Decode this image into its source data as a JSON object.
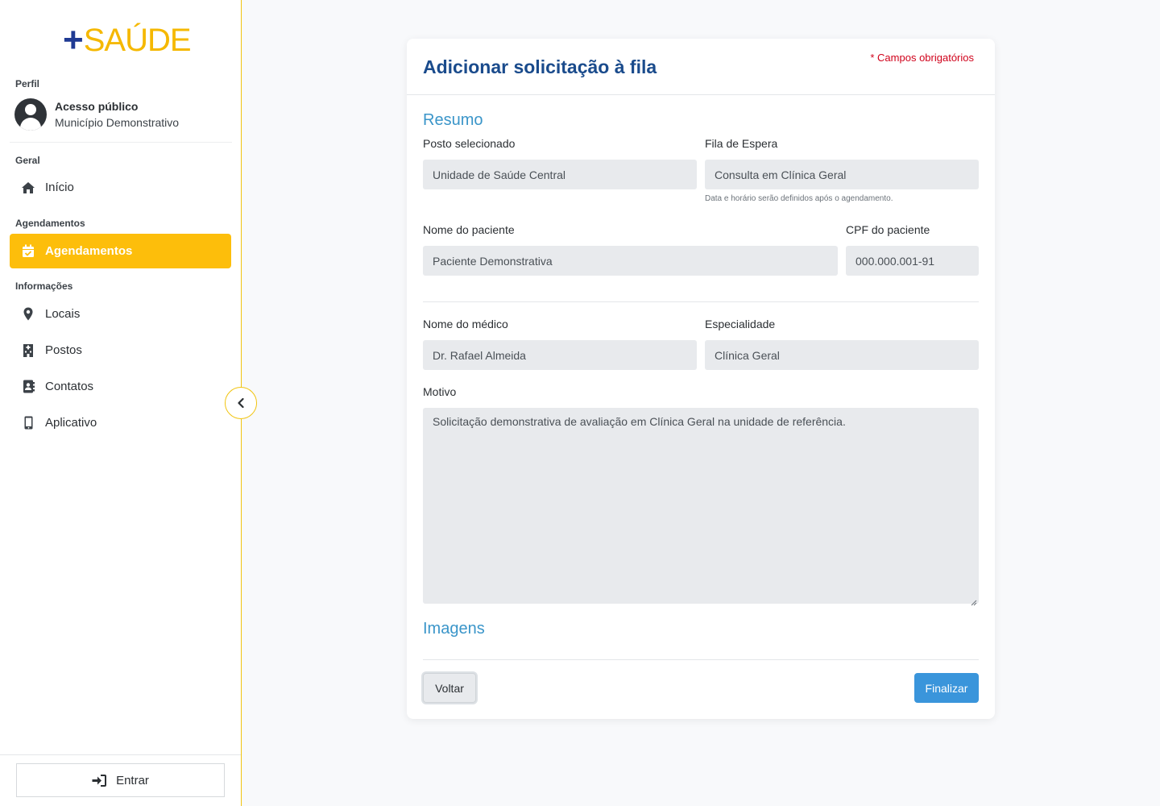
{
  "brand": {
    "plus": "+",
    "word": "SAÚDE"
  },
  "sidebar": {
    "profile_label": "Perfil",
    "profile_name": "Acesso público",
    "profile_sub": "Município Demonstrativo",
    "sections": {
      "general": "Geral",
      "appointments": "Agendamentos",
      "info": "Informações"
    },
    "items": [
      {
        "label": "Início",
        "icon": "home-icon"
      },
      {
        "label": "Agendamentos",
        "icon": "calendar-check-icon",
        "active": true
      },
      {
        "label": "Locais",
        "icon": "map-pin-icon"
      },
      {
        "label": "Postos",
        "icon": "hospital-building-icon"
      },
      {
        "label": "Contatos",
        "icon": "address-book-icon"
      },
      {
        "label": "Aplicativo",
        "icon": "mobile-phone-icon"
      }
    ],
    "login_label": "Entrar"
  },
  "form": {
    "title": "Adicionar solicitação à fila",
    "required_note": "* Campos obrigatórios",
    "section_summary": "Resumo",
    "post_label": "Posto selecionado",
    "post_value": "Unidade de Saúde Central",
    "queue_label": "Fila de Espera",
    "queue_value": "Consulta em Clínica Geral",
    "queue_hint": "Data e horário serão definidos após o agendamento.",
    "patient_label": "Nome do paciente",
    "patient_value": "Paciente Demonstrativa",
    "cpf_label": "CPF do paciente",
    "cpf_value": "000.000.001-91",
    "doctor_label": "Nome do médico",
    "doctor_value": "Dr. Rafael Almeida",
    "specialty_label": "Especialidade",
    "specialty_value": "Clínica Geral",
    "reason_label": "Motivo",
    "reason_value": "Solicitação demonstrativa de avaliação em Clínica Geral na unidade de referência.",
    "section_images": "Imagens",
    "back_label": "Voltar",
    "finish_label": "Finalizar"
  },
  "colors": {
    "accent": "#fdbe0b",
    "primary": "#3a95db",
    "title": "#1a4b8c",
    "required": "#d0021b"
  }
}
